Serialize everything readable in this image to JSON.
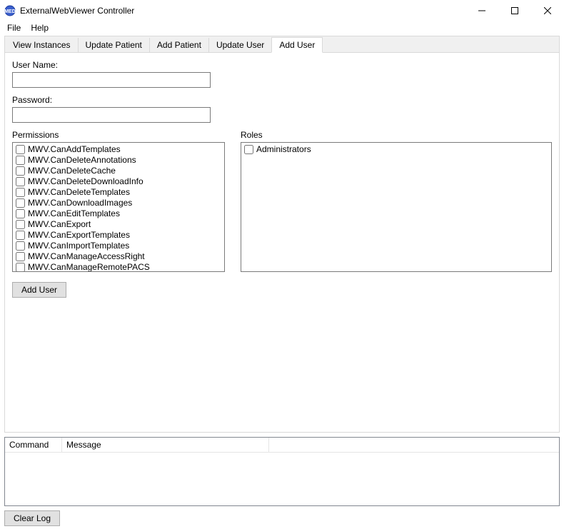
{
  "window": {
    "title": "ExternalWebViewer Controller"
  },
  "menu": {
    "file": "File",
    "help": "Help"
  },
  "tabs": [
    {
      "label": "View Instances"
    },
    {
      "label": "Update Patient"
    },
    {
      "label": "Add Patient"
    },
    {
      "label": "Update User"
    },
    {
      "label": "Add User"
    }
  ],
  "form": {
    "username_label": "User Name:",
    "username_value": "",
    "password_label": "Password:",
    "password_value": "",
    "permissions_label": "Permissions",
    "roles_label": "Roles",
    "add_user_button": "Add User"
  },
  "permissions": [
    "MWV.CanAddTemplates",
    "MWV.CanDeleteAnnotations",
    "MWV.CanDeleteCache",
    "MWV.CanDeleteDownloadInfo",
    "MWV.CanDeleteTemplates",
    "MWV.CanDownloadImages",
    "MWV.CanEditTemplates",
    "MWV.CanExport",
    "MWV.CanExportTemplates",
    "MWV.CanImportTemplates",
    "MWV.CanManageAccessRight",
    "MWV.CanManageRemotePACS"
  ],
  "roles": [
    "Administrators"
  ],
  "log": {
    "col_command": "Command",
    "col_message": "Message"
  },
  "footer": {
    "clear_log": "Clear Log"
  }
}
